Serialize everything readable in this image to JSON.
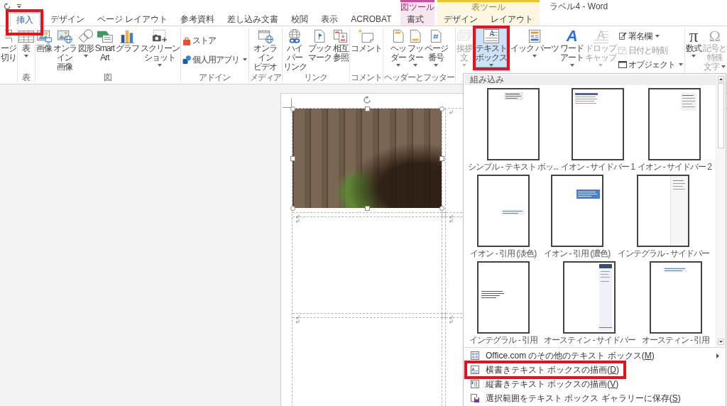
{
  "title": "ラベル4 - Word",
  "tabs": [
    {
      "label": "挿入",
      "selected": true,
      "highlighted": true
    },
    {
      "label": "デザイン",
      "selected": false,
      "highlighted": false
    },
    {
      "label": "ページ レイアウト",
      "selected": false,
      "highlighted": false
    },
    {
      "label": "参考資料",
      "selected": false,
      "highlighted": false
    },
    {
      "label": "差し込み文書",
      "selected": false,
      "highlighted": false
    },
    {
      "label": "校閲",
      "selected": false,
      "highlighted": false
    },
    {
      "label": "表示",
      "selected": false,
      "highlighted": false
    },
    {
      "label": "ACROBAT",
      "selected": false,
      "highlighted": false
    }
  ],
  "context_tabs": [
    {
      "label": "図ツール",
      "color": "#c8509a",
      "tabs": [
        {
          "label": "書式",
          "selected": false
        }
      ]
    },
    {
      "label": "表ツール",
      "color": "#e8c440",
      "tabs": [
        {
          "label": "デザイン",
          "selected": false
        },
        {
          "label": "レイアウト",
          "selected": false
        }
      ]
    }
  ],
  "ribbon": {
    "groups": [
      {
        "buttons": [
          {
            "kind": "large",
            "label": "ージ切り",
            "menu": false,
            "disabled": false,
            "pressed": false,
            "highlighted": false
          }
        ]
      },
      {
        "label": "表",
        "buttons": [
          {
            "kind": "large",
            "label": "表",
            "menu": true,
            "disabled": false,
            "pressed": false,
            "highlighted": false
          }
        ]
      },
      {
        "label": "図",
        "buttons": [
          {
            "kind": "large",
            "label": "画像",
            "menu": false,
            "disabled": false,
            "pressed": false,
            "highlighted": false
          },
          {
            "kind": "large",
            "label": "オンライン画像",
            "menu": false,
            "disabled": false,
            "pressed": false,
            "highlighted": false
          },
          {
            "kind": "large",
            "label": "図形",
            "menu": true,
            "disabled": false,
            "pressed": false,
            "highlighted": false
          },
          {
            "kind": "large",
            "label": "SmartArt",
            "menu": false,
            "disabled": false,
            "pressed": false,
            "highlighted": false
          },
          {
            "kind": "large",
            "label": "グラフ",
            "menu": false,
            "disabled": false,
            "pressed": false,
            "highlighted": false
          },
          {
            "kind": "large",
            "label": "スクリーンショット",
            "menu": true,
            "disabled": false,
            "pressed": false,
            "highlighted": false
          }
        ]
      },
      {
        "label": "アドイン",
        "buttons": [
          {
            "kind": "small",
            "label": "ストア",
            "menu": false,
            "disabled": false,
            "pressed": false,
            "highlighted": false
          },
          {
            "kind": "small",
            "label": "個人用アプリ",
            "menu": true,
            "disabled": false,
            "pressed": false,
            "highlighted": false
          }
        ]
      },
      {
        "label": "メディア",
        "buttons": [
          {
            "kind": "large",
            "label": "オンラインビデオ",
            "menu": false,
            "disabled": false,
            "pressed": false,
            "highlighted": false
          }
        ]
      },
      {
        "label": "リンク",
        "buttons": [
          {
            "kind": "large",
            "label": "ハイパーリンク",
            "menu": false,
            "disabled": false,
            "pressed": false,
            "highlighted": false
          },
          {
            "kind": "large",
            "label": "ブックマーク",
            "menu": false,
            "disabled": false,
            "pressed": false,
            "highlighted": false
          },
          {
            "kind": "large",
            "label": "相互参照",
            "menu": false,
            "disabled": false,
            "pressed": false,
            "highlighted": false
          }
        ]
      },
      {
        "label": "コメント",
        "buttons": [
          {
            "kind": "large",
            "label": "コメント",
            "menu": false,
            "disabled": false,
            "pressed": false,
            "highlighted": false
          }
        ]
      },
      {
        "label": "ヘッダーとフッター",
        "buttons": [
          {
            "kind": "large",
            "label": "ヘッダー",
            "menu": true,
            "disabled": false,
            "pressed": false,
            "highlighted": false
          },
          {
            "kind": "large",
            "label": "フッター",
            "menu": true,
            "disabled": false,
            "pressed": false,
            "highlighted": false
          },
          {
            "kind": "large",
            "label": "ページ番号",
            "menu": true,
            "disabled": false,
            "pressed": false,
            "highlighted": false
          }
        ]
      },
      {
        "buttons": [
          {
            "kind": "large",
            "label": "挨拶文",
            "menu": true,
            "disabled": true,
            "pressed": false,
            "highlighted": false
          },
          {
            "kind": "large",
            "label": "テキストボックス",
            "glyph": "A",
            "menu": true,
            "disabled": false,
            "pressed": true,
            "highlighted": true
          },
          {
            "kind": "large",
            "label": "イック パーツ",
            "menu": true,
            "disabled": false,
            "pressed": false,
            "highlighted": false
          },
          {
            "kind": "large",
            "label": "ワードアート",
            "glyph": "A",
            "menu": true,
            "disabled": false,
            "pressed": false,
            "highlighted": false
          },
          {
            "kind": "large",
            "label": "ドロップキャップ",
            "glyph": "A",
            "menu": true,
            "disabled": true,
            "pressed": false,
            "highlighted": false
          },
          {
            "kind": "small",
            "label": "署名欄",
            "menu": true,
            "disabled": false,
            "pressed": false,
            "highlighted": false
          },
          {
            "kind": "small",
            "label": "日付と時刻",
            "menu": false,
            "disabled": true,
            "pressed": false,
            "highlighted": false
          },
          {
            "kind": "small",
            "label": "オブジェクト",
            "menu": true,
            "disabled": false,
            "pressed": false,
            "highlighted": false
          }
        ]
      },
      {
        "buttons": [
          {
            "kind": "large",
            "label": "数式",
            "glyph": "π",
            "menu": true,
            "disabled": false,
            "pressed": false,
            "highlighted": false
          },
          {
            "kind": "large",
            "label": "記号と特殊文字",
            "glyph": "Ω",
            "menu": true,
            "disabled": true,
            "pressed": false,
            "highlighted": false
          }
        ]
      }
    ]
  },
  "gallery": {
    "heading": "組み込み",
    "items": [
      {
        "label": "シンプル - テキスト ボッ...",
        "kind": "simple"
      },
      {
        "label": "イオン - サイドバー 1",
        "kind": "banner"
      },
      {
        "label": "イオン - サイドバー 2",
        "kind": "corner"
      },
      {
        "label": "イオン - 引用 (淡色)",
        "kind": "quote"
      },
      {
        "label": "イオン - 引用 (濃色)",
        "kind": "callout"
      },
      {
        "label": "インテグラル - サイドバー",
        "kind": "sidebar"
      },
      {
        "label": "インテグラル - 引用",
        "kind": "pullquote"
      },
      {
        "label": "オースティン - サイドバー",
        "kind": "column"
      },
      {
        "label": "オースティン - 引用",
        "kind": "heading"
      }
    ]
  },
  "menu": [
    {
      "label": "Office.com のその他のテキスト ボックス(M)",
      "submenu": true,
      "highlighted": false
    },
    {
      "label": "横書きテキスト ボックスの描画(D)",
      "submenu": false,
      "highlighted": true
    },
    {
      "label": "縦書きテキスト ボックスの描画(V)",
      "submenu": false,
      "highlighted": false
    },
    {
      "label": "選択範囲をテキスト ボックス ギャラリーに保存(S)",
      "submenu": false,
      "highlighted": false
    }
  ],
  "document": {
    "image": {
      "selected": true
    }
  }
}
